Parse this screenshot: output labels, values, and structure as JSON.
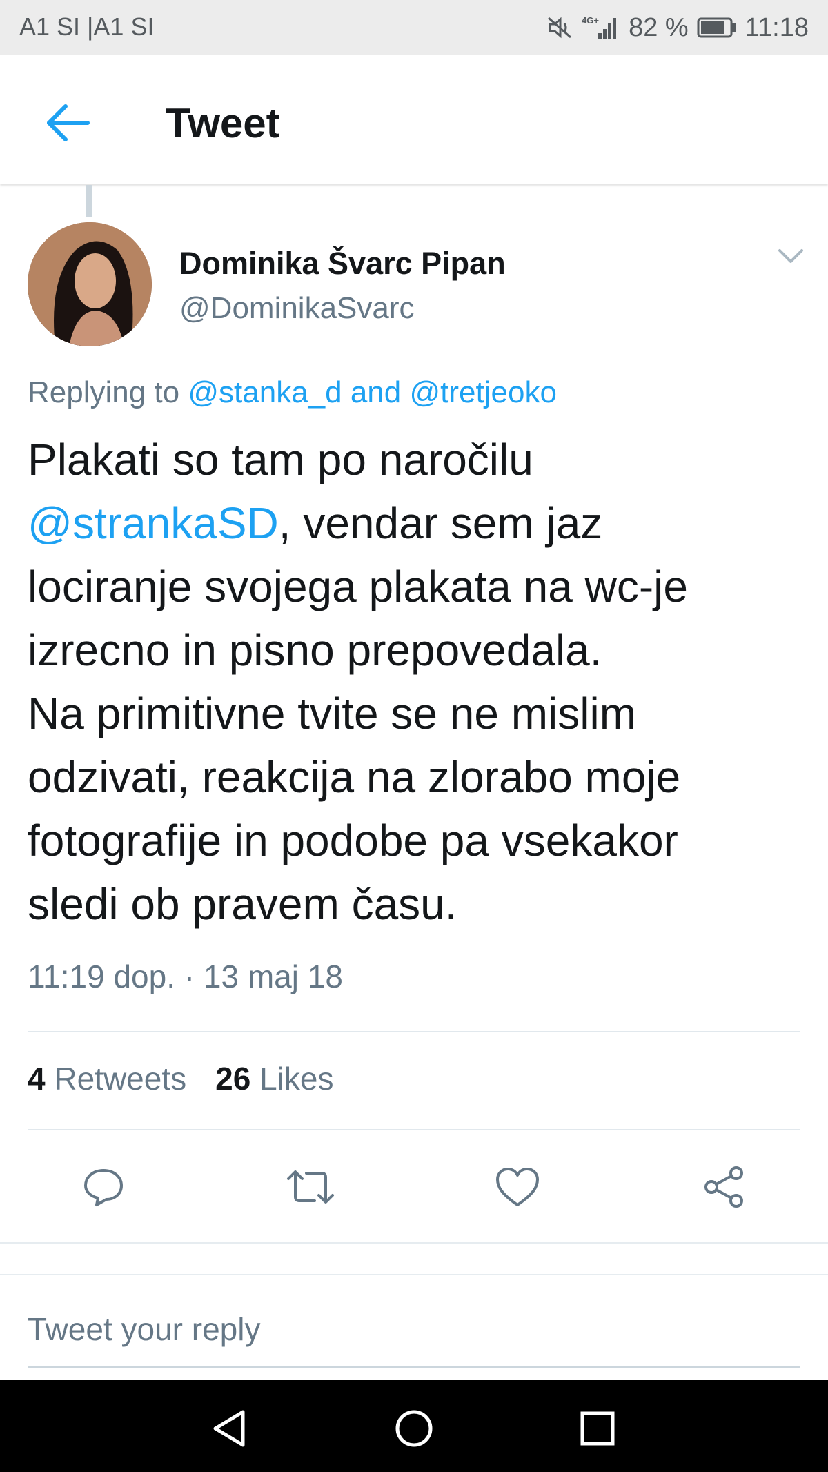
{
  "status_bar": {
    "carrier": "A1 SI |A1 SI",
    "network": "4G+",
    "battery": "82 %",
    "time": "11:18",
    "icons": [
      "mute-icon",
      "signal-icon",
      "battery-icon"
    ]
  },
  "header": {
    "title": "Tweet",
    "back_icon": "arrow-left-icon"
  },
  "tweet": {
    "author_name": "Dominika Švarc Pipan",
    "author_handle": "@DominikaSvarc",
    "replying_prefix": "Replying to ",
    "replying_to_1": "@stanka_d",
    "replying_and": " and ",
    "replying_to_2": "@tretjeoko",
    "text_part1": "Plakati so tam po naročilu\n",
    "text_mention": "@strankaSD",
    "text_part2": ", vendar sem jaz\nlociranje svojega plakata na wc-je\nizrecno in pisno prepovedala.\nNa primitivne tvite se ne mislim\nodzivati, reakcija na zlorabo moje\nfotografije in podobe pa vsekakor\nsledi ob pravem času.",
    "timestamp": "11:19 dop. · 13 maj 18"
  },
  "stats": {
    "retweets_count": "4",
    "retweets_label": "Retweets",
    "likes_count": "26",
    "likes_label": "Likes"
  },
  "actions": [
    "reply-icon",
    "retweet-icon",
    "like-icon",
    "share-icon"
  ],
  "reply_box": {
    "placeholder": "Tweet your reply"
  },
  "colors": {
    "accent": "#1da1f2",
    "secondary_text": "#657786",
    "primary_text": "#14171a"
  }
}
